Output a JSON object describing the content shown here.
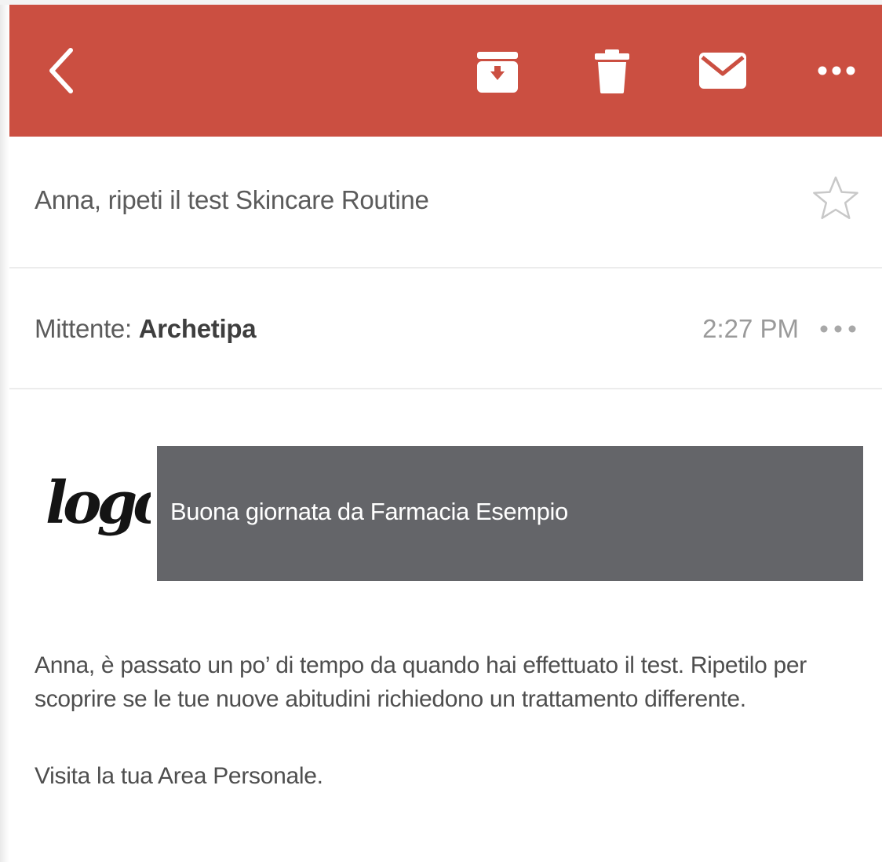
{
  "toolbar": {
    "background": "#cb4f41",
    "back_icon": "chevron-left-icon",
    "archive_icon": "archive-icon",
    "delete_icon": "trash-icon",
    "mark_icon": "envelope-icon",
    "more_icon": "more-horizontal-icon"
  },
  "message": {
    "subject": "Anna, ripeti il test Skincare Routine",
    "star_icon": "star-outline-icon",
    "sender_label": "Mittente: ",
    "sender_name": "Archetipa",
    "time": "2:27 PM",
    "sender_more_icon": "more-horizontal-icon"
  },
  "email_body": {
    "logo_text": "logo",
    "banner_text": "Buona giornata da Farmacia Esempio",
    "banner_color": "#646569",
    "paragraph": "Anna, è passato un po’ di tempo da quando hai effettuato il test. Ripetilo per scoprire se le tue nuove abitudini richiedono un trattamento differente.",
    "visit_line": "Visita la tua Area Personale."
  }
}
